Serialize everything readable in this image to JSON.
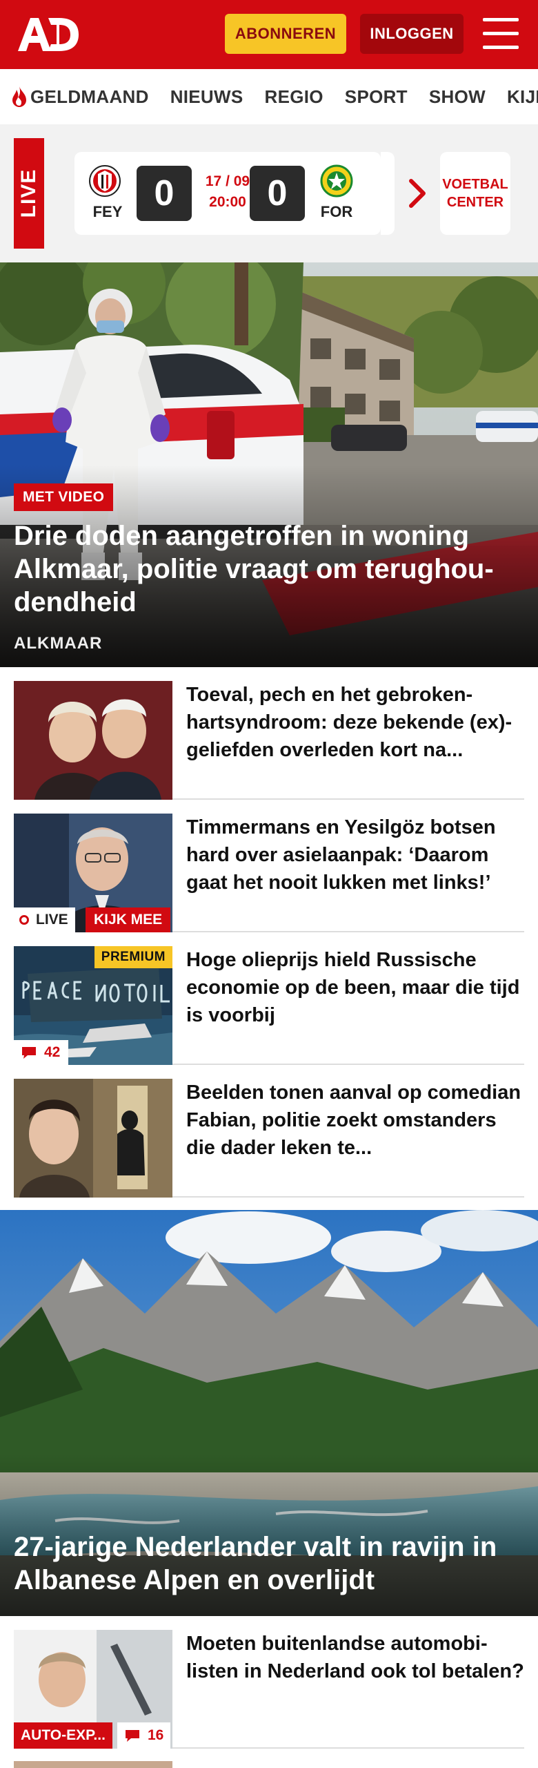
{
  "header": {
    "logo_text": "AD",
    "subscribe_label": "ABONNEREN",
    "login_label": "INLOGGEN",
    "brand_color": "#d10a11"
  },
  "nav": {
    "items": [
      {
        "label": "GELDMAAND",
        "icon": "flame-icon"
      },
      {
        "label": "NIEUWS"
      },
      {
        "label": "REGIO"
      },
      {
        "label": "SPORT"
      },
      {
        "label": "SHOW"
      },
      {
        "label": "KIJK"
      }
    ]
  },
  "live_scores": {
    "live_label": "LIVE",
    "match": {
      "home_team": "FEY",
      "home_score": "0",
      "away_team": "FOR",
      "away_score": "0",
      "date": "17 / 09",
      "time": "20:00"
    },
    "voetbal_center_line1": "VOETBAL",
    "voetbal_center_line2": "CENTER"
  },
  "hero": {
    "badge": "MET VIDEO",
    "title": "Drie doden aangetroffen in woning Alkmaar, politie vraagt om terughou­dendheid",
    "region": "ALKMAAR"
  },
  "articles": [
    {
      "title": "Toeval, pech en het gebroken-hartsyndroom: deze bekende (ex)-geliefden overleden kort na..."
    },
    {
      "title": "Timmermans en Yesilgöz botsen hard over asielaanpak: ‘Daarom gaat het nooit lukken met links!’",
      "live_label": "LIVE",
      "kijk_label": "KIJK MEE"
    },
    {
      "title": "Hoge olieprijs hield Russische economie op de been, maar die tijd is voorbij",
      "premium_label": "PREMIUM",
      "comments": "42"
    },
    {
      "title": "Beelden tonen aanval op comedian Fabian, politie zoekt omstanders die dader leken te..."
    }
  ],
  "hero2": {
    "title": "27-jarige Nederlander valt in ravijn in Albanese Alpen en overlijdt"
  },
  "articles2": [
    {
      "title": "Moeten buitenlandse automobi­listen in Nederland ook tol betalen?",
      "category": "AUTO-EXP...",
      "comments": "16"
    }
  ]
}
